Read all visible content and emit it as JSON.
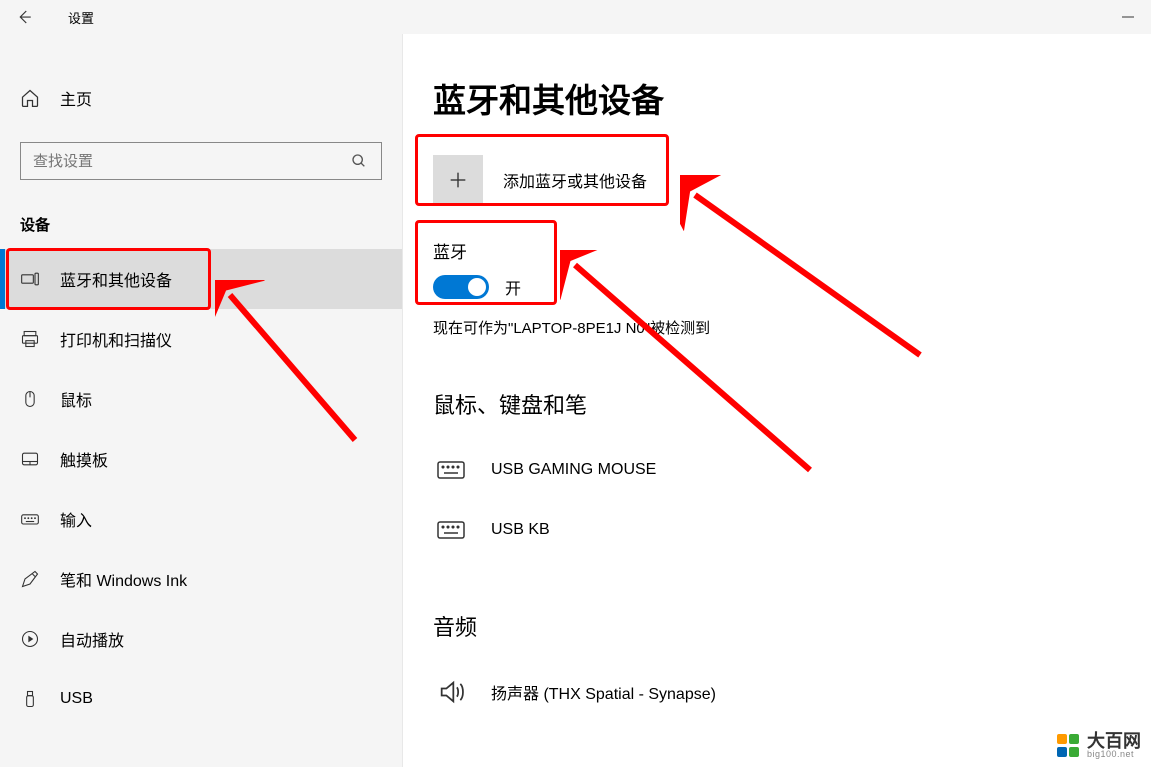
{
  "titlebar": {
    "title": "设置"
  },
  "sidebar": {
    "home": "主页",
    "search_placeholder": "查找设置",
    "section": "设备",
    "items": [
      {
        "label": "蓝牙和其他设备"
      },
      {
        "label": "打印机和扫描仪"
      },
      {
        "label": "鼠标"
      },
      {
        "label": "触摸板"
      },
      {
        "label": "输入"
      },
      {
        "label": "笔和 Windows Ink"
      },
      {
        "label": "自动播放"
      },
      {
        "label": "USB"
      }
    ]
  },
  "main": {
    "heading": "蓝牙和其他设备",
    "add_device": "添加蓝牙或其他设备",
    "bt_label": "蓝牙",
    "toggle_state": "开",
    "discover_text": "现在可作为\"LAPTOP-8PE1J   N0\"被检测到",
    "cat1": "鼠标、键盘和笔",
    "dev1": "USB GAMING MOUSE",
    "dev2": "USB KB",
    "cat2": "音频",
    "dev3": "扬声器 (THX Spatial - Synapse)"
  },
  "watermark": {
    "name": "大百网",
    "url": "big100.net"
  }
}
